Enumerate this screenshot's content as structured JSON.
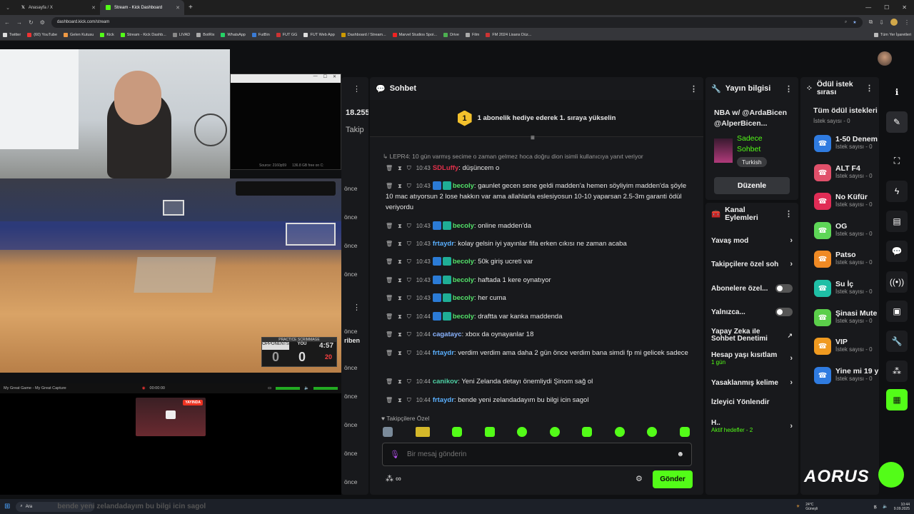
{
  "browser": {
    "tabs": [
      {
        "label": "Anasayfa / X"
      },
      {
        "label": "Stream - Kick Dashboard"
      }
    ],
    "url": "dashboard.kick.com/stream",
    "bookmarks": [
      "Twitter",
      "(60) YouTube",
      "Gelen Kutusu",
      "Kick",
      "Stream - Kick Dashb...",
      "LIVAD",
      "BotRix",
      "WhatsApp",
      "FutBin",
      "FUT GG",
      "FUT Web App",
      "Dashboard / Stream...",
      "Marvel Studios Spoi...",
      "Drive",
      "Film",
      "FM 2024 Lisans Düz..."
    ],
    "all_bookmarks": "Tüm Yer İşaretleri"
  },
  "left": {
    "stat": "18.255",
    "follow_partial": "Takip",
    "once": "önce",
    "riben": "riben",
    "webcam_source": "Source: 2160p59",
    "webcam_free": "136.8 GB free on C:",
    "capture_title": "My Great Game - My Great Capture",
    "capture_time": "00:00:00",
    "live_badge": "YAYINDA",
    "score": {
      "label": "PRACTICE SCRIMMAGE",
      "opp": "OPPONENTS",
      "you": "YOU",
      "opp_score": "0",
      "you_score": "0",
      "clock": "4:57",
      "shot": "20"
    }
  },
  "chat": {
    "title": "Sohbet",
    "promo": "1 abonelik hediye ederek 1. sıraya yükselin",
    "promo_num": "1",
    "reply_note": "LEPR4: 10 gün varmış secime o zaman gelmez hoca doğru dion isimli kullanıcıya yanıt veriyor",
    "messages": [
      {
        "time": "10:43",
        "user": "SDLuffy",
        "color": "#e0304a",
        "badges": 0,
        "text": "düşüncem o"
      },
      {
        "time": "10:43",
        "user": "becoly",
        "color": "#53e36a",
        "badges": 2,
        "text": "gaunlet gecen sene geldi madden'a hemen söyliyim madden'da şöyle 10 mac atıyorsun 2 lose hakkın var ama allahlarla eslesiyosun 10-10 yaparsan 2.5-3m garanti ödül veriyordu"
      },
      {
        "time": "10:43",
        "user": "becoly",
        "color": "#53e36a",
        "badges": 2,
        "text": "online madden'da"
      },
      {
        "time": "10:43",
        "user": "frtaydr",
        "color": "#5ab0ff",
        "badges": 0,
        "text": "kolay gelsin iyi yayınlar fifa erken cıkısı ne zaman acaba"
      },
      {
        "time": "10:43",
        "user": "becoly",
        "color": "#53e36a",
        "badges": 2,
        "text": "50k giriş ucreti var"
      },
      {
        "time": "10:43",
        "user": "becoly",
        "color": "#53e36a",
        "badges": 2,
        "text": "haftada 1 kere oynatıyor"
      },
      {
        "time": "10:43",
        "user": "becoly",
        "color": "#53e36a",
        "badges": 2,
        "text": "her cuma"
      },
      {
        "time": "10:44",
        "user": "becoly",
        "color": "#53e36a",
        "badges": 2,
        "text": "draftta var kanka maddenda"
      },
      {
        "time": "10:44",
        "user": "cagatayc",
        "color": "#8ab4ff",
        "badges": 0,
        "text": "xbox da oynayanlar 18"
      },
      {
        "time": "10:44",
        "user": "frtaydr",
        "color": "#5ab0ff",
        "badges": 0,
        "text": "verdim verdim ama daha 2 gün önce verdim bana simdi fp mi gelicek sadece"
      },
      {
        "time": "10:44",
        "user": "canikov",
        "color": "#4fd1a5",
        "badges": 0,
        "text": "Yeni Zelanda detayı önemliydi Şinom sağ ol"
      },
      {
        "time": "10:44",
        "user": "frtaydr",
        "color": "#5ab0ff",
        "badges": 0,
        "text": "bende yeni zelandadayım bu bilgi icin sagol"
      }
    ],
    "followers_only": "Takipçilere Özel",
    "input_placeholder": "Bir mesaj gönderin",
    "send_label": "Gönder"
  },
  "stream_info": {
    "title": "Yayın bilgisi",
    "stream_title": "NBA w/ @ArdaBicen @AlperBicen...",
    "category": "Sadece Sohbet",
    "language": "Turkish",
    "edit_label": "Düzenle"
  },
  "channel_actions": {
    "title": "Kanal Eylemleri",
    "items": [
      {
        "label": "Yavaş mod",
        "kind": "chevron"
      },
      {
        "label": "Takipçilere özel soh",
        "kind": "chevron"
      },
      {
        "label": "Abonelere özel...",
        "kind": "toggle"
      },
      {
        "label": "Yalnızca...",
        "kind": "toggle"
      },
      {
        "label": "Yapay Zeka ile Sohbet Denetimi",
        "kind": "external"
      },
      {
        "label": "Hesap yaşı kısıtlam",
        "sub": "1 gün",
        "kind": "chevron"
      },
      {
        "label": "Yasaklanmış kelime",
        "kind": "chevron"
      },
      {
        "label": "İzleyici Yönlendir",
        "kind": "none"
      },
      {
        "label": "H..",
        "sub": "Aktif hedefler - 2",
        "kind": "chevron"
      }
    ]
  },
  "rewards": {
    "title": "Ödül istek sırası",
    "all_label": "Tüm ödül istekleri",
    "all_count": "İstek sayısı - 0",
    "items": [
      {
        "label": "1-50 Denem",
        "count": "İstek sayısı - 0",
        "color": "#2f7be0"
      },
      {
        "label": "ALT F4",
        "count": "İstek sayısı - 0",
        "color": "#e0506a"
      },
      {
        "label": "No Küfür",
        "count": "İstek sayısı - 0",
        "color": "#e02c55"
      },
      {
        "label": "OG",
        "count": "İstek sayısı - 0",
        "color": "#5ed657"
      },
      {
        "label": "Patso",
        "count": "İstek sayısı - 0",
        "color": "#f08a24"
      },
      {
        "label": "Su İç",
        "count": "İstek sayısı - 0",
        "color": "#1fbfa6"
      },
      {
        "label": "Şinasi Mute",
        "count": "İstek sayısı - 0",
        "color": "#5bcf4a"
      },
      {
        "label": "VIP",
        "count": "İstek sayısı - 0",
        "color": "#f09a20"
      },
      {
        "label": "Yine mi 19 y",
        "count": "İstek sayısı - 0",
        "color": "#2f7be0"
      }
    ]
  },
  "taskbar": {
    "search": "Ara",
    "ghost_text": "bende yeni zelandadayım bu bilgi icin sagol",
    "weather_temp": "24°C",
    "weather_desc": "Güneşli",
    "time": "10:44",
    "date": "9.09.2025"
  },
  "brand": "AORUS",
  "colors": {
    "accent": "#53fc18",
    "panel": "#18191c",
    "bg": "#0f1012"
  }
}
